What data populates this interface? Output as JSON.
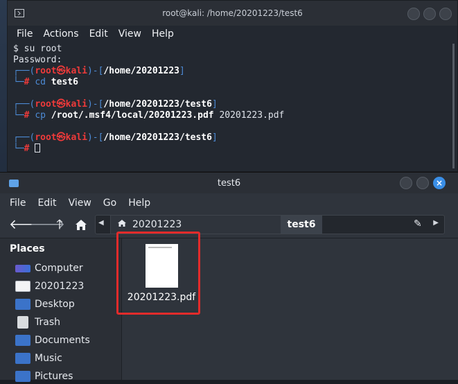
{
  "terminal": {
    "title": "root@kali: /home/20201223/test6",
    "menu": [
      "File",
      "Actions",
      "Edit",
      "View",
      "Help"
    ],
    "lines": {
      "l1": "$ su root",
      "l2": "Password:",
      "p1_user": "root㉿kali",
      "p1_path": "/home/20201223",
      "p1_cmd": "cd",
      "p1_arg": "test6",
      "p2_user": "root㉿kali",
      "p2_path": "/home/20201223/test6",
      "p2_cmd": "cp",
      "p2_arg": "/root/.msf4/local/20201223.pdf",
      "p2_arg2": "20201223.pdf",
      "p3_user": "root㉿kali",
      "p3_path": "/home/20201223/test6"
    }
  },
  "file_manager": {
    "title": "test6",
    "menu": [
      "File",
      "Edit",
      "View",
      "Go",
      "Help"
    ],
    "path": {
      "parent": "20201223",
      "current": "test6"
    },
    "sidebar": {
      "heading": "Places",
      "items": [
        {
          "label": "Computer",
          "icon": "computer-icon"
        },
        {
          "label": "20201223",
          "icon": "home-folder-icon"
        },
        {
          "label": "Desktop",
          "icon": "desktop-folder-icon"
        },
        {
          "label": "Trash",
          "icon": "trash-icon"
        },
        {
          "label": "Documents",
          "icon": "documents-folder-icon"
        },
        {
          "label": "Music",
          "icon": "music-folder-icon"
        },
        {
          "label": "Pictures",
          "icon": "pictures-folder-icon"
        }
      ]
    },
    "files": [
      {
        "name": "20201223.pdf",
        "icon": "pdf-file-icon"
      }
    ]
  },
  "colors": {
    "prompt_red": "#ee3a3a",
    "prompt_blue": "#4d8bd6",
    "highlight_box": "#e32b2b",
    "folder_blue": "#3b73c9"
  }
}
